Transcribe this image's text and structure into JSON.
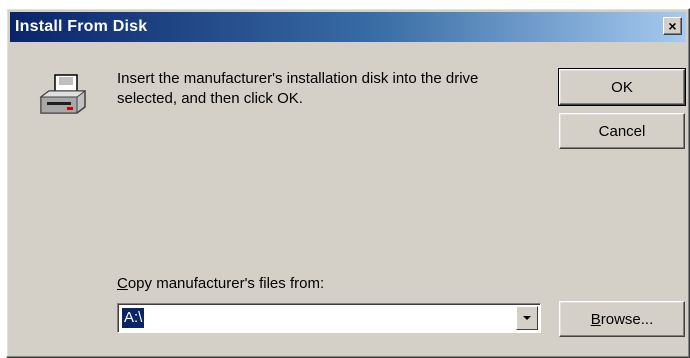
{
  "window": {
    "title": "Install From Disk",
    "close_glyph": "×"
  },
  "icon": {
    "name": "disk-drive-icon"
  },
  "message": "Insert the manufacturer's installation disk into the drive selected, and then click OK.",
  "buttons": {
    "ok_label": "OK",
    "cancel_label": "Cancel",
    "browse_prefix": "",
    "browse_mnemonic": "B",
    "browse_rest": "rowse..."
  },
  "copy_from": {
    "label_mnemonic": "C",
    "label_rest": "opy manufacturer's files from:",
    "value": "A:\\"
  },
  "colors": {
    "dialog_bg": "#d4d0c8",
    "title_start": "#0a246a",
    "title_end": "#a6caf0",
    "selection": "#0a246a"
  }
}
